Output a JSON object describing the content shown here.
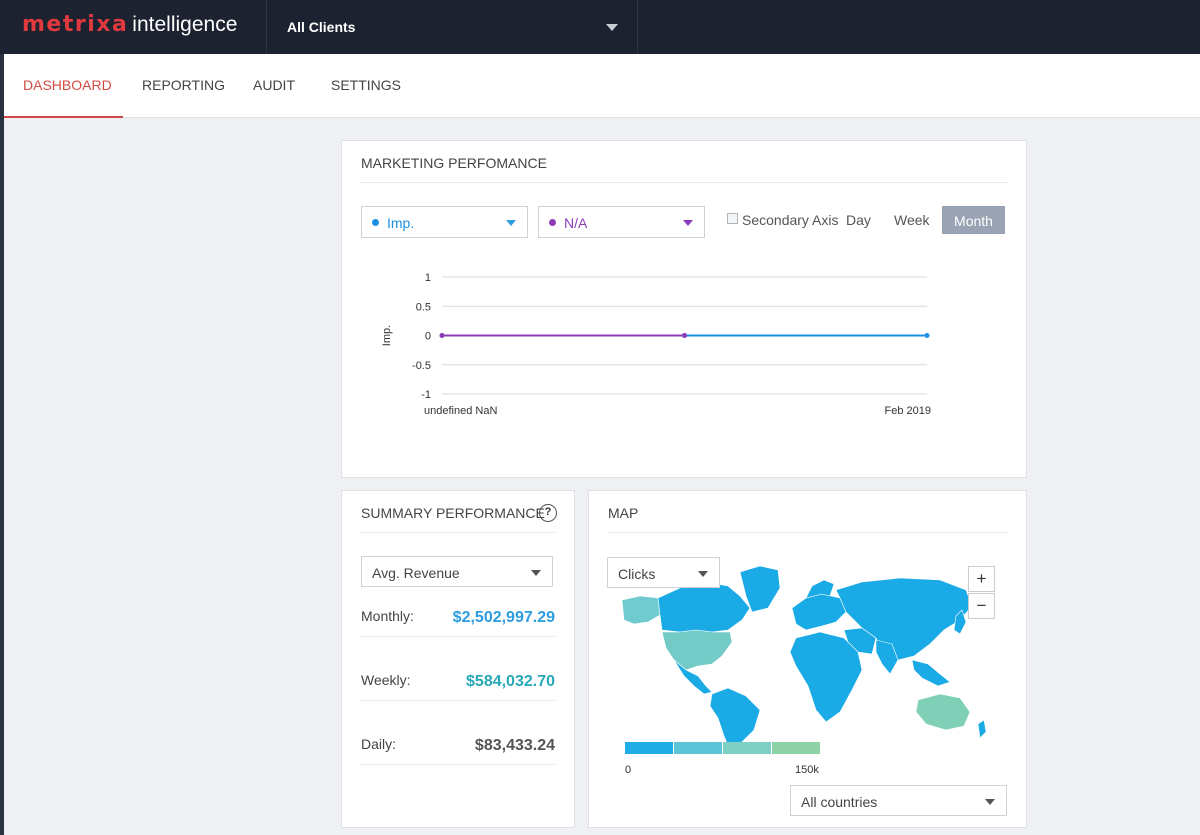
{
  "header": {
    "logo_brand": "metrixa",
    "logo_sub": "intelligence",
    "client_selector": "All Clients"
  },
  "nav": {
    "items": [
      {
        "label": "DASHBOARD",
        "active": true
      },
      {
        "label": "REPORTING",
        "active": false
      },
      {
        "label": "AUDIT",
        "active": false
      },
      {
        "label": "SETTINGS",
        "active": false
      }
    ]
  },
  "marketing": {
    "title": "MARKETING PERFOMANCE",
    "metric1": "Imp.",
    "metric2": "N/A",
    "secondary_axis": "Secondary Axis",
    "toggles": {
      "day": "Day",
      "week": "Week",
      "month": "Month"
    },
    "colors": {
      "metric1": "#1a8fe3",
      "metric2": "#8e3cb8"
    }
  },
  "chart_data": {
    "type": "line",
    "title": "",
    "ylabel": "Imp.",
    "xlabel": "",
    "ylim": [
      -1,
      1
    ],
    "yticks": [
      "1",
      "0.5",
      "0",
      "-0.5",
      "-1"
    ],
    "x": [
      "undefined NaN",
      "",
      "Feb 2019"
    ],
    "series": [
      {
        "name": "Imp.",
        "values": [
          0,
          0,
          0
        ],
        "color": "#1a8fe3"
      },
      {
        "name": "N/A",
        "values": [
          0,
          0,
          null
        ],
        "color": "#8e3cb8"
      }
    ],
    "grid": true
  },
  "summary": {
    "title": "SUMMARY PERFORMANCE",
    "help": "?",
    "metric": "Avg. Revenue",
    "rows": [
      {
        "label": "Monthly:",
        "value": "$2,502,997.29",
        "color": "#2d9de0"
      },
      {
        "label": "Weekly:",
        "value": "$584,032.70",
        "color": "#27a9b8"
      },
      {
        "label": "Daily:",
        "value": "$83,433.24",
        "color": "#555555"
      }
    ]
  },
  "map": {
    "title": "MAP",
    "metric": "Clicks",
    "zoom_in": "+",
    "zoom_out": "−",
    "legend_min": "0",
    "legend_max": "150k",
    "legend_colors": [
      "#20aee6",
      "#5cc4d6",
      "#7fd0c4",
      "#8fd2a8"
    ],
    "country_filter": "All countries"
  }
}
